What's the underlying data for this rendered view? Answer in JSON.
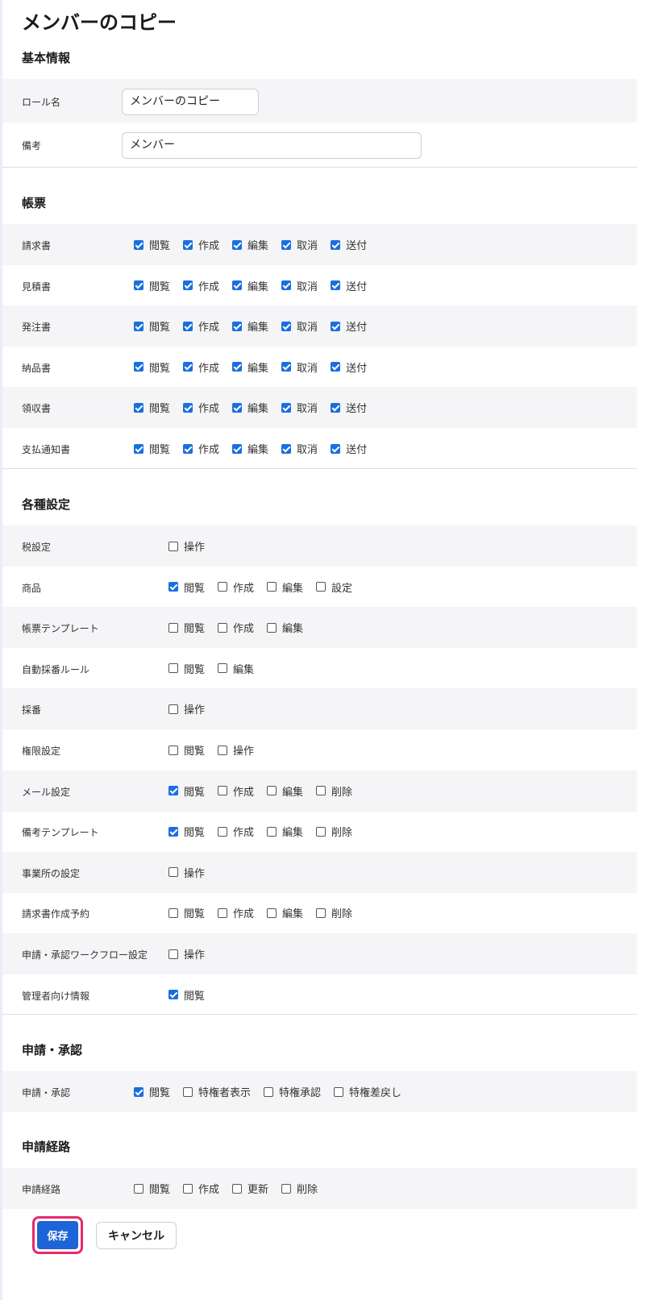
{
  "title": "メンバーのコピー",
  "basic": {
    "heading": "基本情報",
    "role_label": "ロール名",
    "role_value": "メンバーのコピー",
    "note_label": "備考",
    "note_value": "メンバー"
  },
  "forms": {
    "heading": "帳票",
    "options": [
      "閲覧",
      "作成",
      "編集",
      "取消",
      "送付"
    ],
    "rows": [
      {
        "label": "請求書",
        "checked": [
          true,
          true,
          true,
          true,
          true
        ]
      },
      {
        "label": "見積書",
        "checked": [
          true,
          true,
          true,
          true,
          true
        ]
      },
      {
        "label": "発注書",
        "checked": [
          true,
          true,
          true,
          true,
          true
        ]
      },
      {
        "label": "納品書",
        "checked": [
          true,
          true,
          true,
          true,
          true
        ]
      },
      {
        "label": "領収書",
        "checked": [
          true,
          true,
          true,
          true,
          true
        ]
      },
      {
        "label": "支払通知書",
        "checked": [
          true,
          true,
          true,
          true,
          true
        ]
      }
    ]
  },
  "settings": {
    "heading": "各種設定",
    "rows": [
      {
        "label": "税設定",
        "options": [
          {
            "t": "操作",
            "c": false
          }
        ]
      },
      {
        "label": "商品",
        "options": [
          {
            "t": "閲覧",
            "c": true
          },
          {
            "t": "作成",
            "c": false
          },
          {
            "t": "編集",
            "c": false
          },
          {
            "t": "設定",
            "c": false
          }
        ]
      },
      {
        "label": "帳票テンプレート",
        "options": [
          {
            "t": "閲覧",
            "c": false
          },
          {
            "t": "作成",
            "c": false
          },
          {
            "t": "編集",
            "c": false
          }
        ]
      },
      {
        "label": "自動採番ルール",
        "options": [
          {
            "t": "閲覧",
            "c": false
          },
          {
            "t": "編集",
            "c": false
          }
        ]
      },
      {
        "label": "採番",
        "options": [
          {
            "t": "操作",
            "c": false
          }
        ]
      },
      {
        "label": "権限設定",
        "options": [
          {
            "t": "閲覧",
            "c": false
          },
          {
            "t": "操作",
            "c": false
          }
        ]
      },
      {
        "label": "メール設定",
        "options": [
          {
            "t": "閲覧",
            "c": true
          },
          {
            "t": "作成",
            "c": false
          },
          {
            "t": "編集",
            "c": false
          },
          {
            "t": "削除",
            "c": false
          }
        ]
      },
      {
        "label": "備考テンプレート",
        "options": [
          {
            "t": "閲覧",
            "c": true
          },
          {
            "t": "作成",
            "c": false
          },
          {
            "t": "編集",
            "c": false
          },
          {
            "t": "削除",
            "c": false
          }
        ]
      },
      {
        "label": "事業所の設定",
        "options": [
          {
            "t": "操作",
            "c": false
          }
        ]
      },
      {
        "label": "請求書作成予約",
        "options": [
          {
            "t": "閲覧",
            "c": false
          },
          {
            "t": "作成",
            "c": false
          },
          {
            "t": "編集",
            "c": false
          },
          {
            "t": "削除",
            "c": false
          }
        ]
      },
      {
        "label": "申請・承認ワークフロー設定",
        "options": [
          {
            "t": "操作",
            "c": false
          }
        ]
      },
      {
        "label": "管理者向け情報",
        "options": [
          {
            "t": "閲覧",
            "c": true
          }
        ]
      }
    ]
  },
  "approval": {
    "heading": "申請・承認",
    "rows": [
      {
        "label": "申請・承認",
        "options": [
          {
            "t": "閲覧",
            "c": true
          },
          {
            "t": "特権者表示",
            "c": false
          },
          {
            "t": "特権承認",
            "c": false
          },
          {
            "t": "特権差戻し",
            "c": false
          }
        ]
      }
    ]
  },
  "route": {
    "heading": "申請経路",
    "rows": [
      {
        "label": "申請経路",
        "options": [
          {
            "t": "閲覧",
            "c": false
          },
          {
            "t": "作成",
            "c": false
          },
          {
            "t": "更新",
            "c": false
          },
          {
            "t": "削除",
            "c": false
          }
        ]
      }
    ]
  },
  "buttons": {
    "save": "保存",
    "cancel": "キャンセル"
  },
  "colors": {
    "accent": "#1a6fdf",
    "save_bg": "#1d64d8",
    "highlight_border": "#e8286e",
    "row_stripe": "#f5f4f6"
  }
}
